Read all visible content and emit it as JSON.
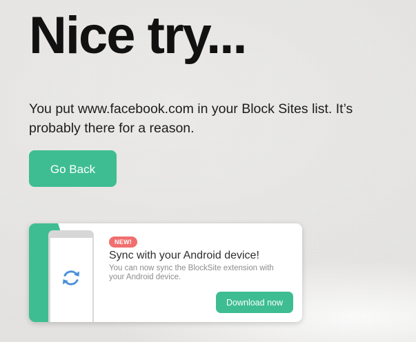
{
  "page": {
    "headline": "Nice try...",
    "message": "You put www.facebook.com in your Block Sites list. It’s probably there for a reason.",
    "go_back_label": "Go Back"
  },
  "promo": {
    "badge": "NEW!",
    "title": "Sync with your Android device!",
    "description": "You can now sync the BlockSite extension with your Android device.",
    "download_label": "Download now",
    "icon": "sync-icon"
  },
  "colors": {
    "accent": "#3ebd92",
    "badge": "#f06e6e",
    "headline": "#111111",
    "icon_blue": "#4a90d9"
  }
}
